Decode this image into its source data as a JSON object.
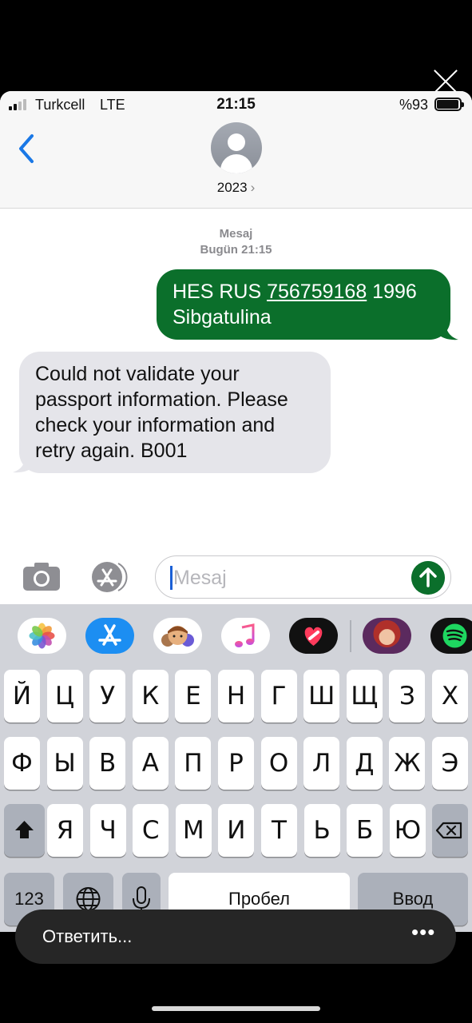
{
  "status_bar": {
    "carrier": "Turkcell",
    "network": "LTE",
    "time": "21:15",
    "battery": "%93"
  },
  "header": {
    "contact": "2023",
    "contact_chevron": "›"
  },
  "thread": {
    "service_label": "Mesaj",
    "timestamp": "Bugün 21:15",
    "messages": [
      {
        "direction": "outgoing",
        "prefix": "HES RUS ",
        "link_number": "756759168",
        "suffix_line1": " 1996",
        "line2": "Sibgatulina"
      },
      {
        "direction": "incoming",
        "lines": [
          "Could not validate your",
          "passport information. Please",
          "check your information and",
          "retry again. B001"
        ]
      }
    ]
  },
  "composer": {
    "placeholder": "Mesaj"
  },
  "app_drawer": [
    "photos-icon",
    "app-store-icon",
    "memoji-icon",
    "music-icon",
    "digital-touch-icon",
    "game-app-icon",
    "spotify-icon"
  ],
  "keyboard": {
    "row1": [
      "Й",
      "Ц",
      "У",
      "К",
      "Е",
      "Н",
      "Г",
      "Ш",
      "Щ",
      "З",
      "Х"
    ],
    "row2": [
      "Ф",
      "Ы",
      "В",
      "А",
      "П",
      "Р",
      "О",
      "Л",
      "Д",
      "Ж",
      "Э"
    ],
    "row3": [
      "Я",
      "Ч",
      "С",
      "М",
      "И",
      "Т",
      "Ь",
      "Б",
      "Ю"
    ],
    "numbers_key": "123",
    "space_key": "Пробел",
    "return_key": "Ввод"
  },
  "reply_bar": {
    "label": "Ответить...",
    "more": "•••"
  },
  "colors": {
    "outgoing_bubble": "#0b6f2b",
    "incoming_bubble": "#e5e5ea",
    "accent_blue": "#1a78e6"
  }
}
